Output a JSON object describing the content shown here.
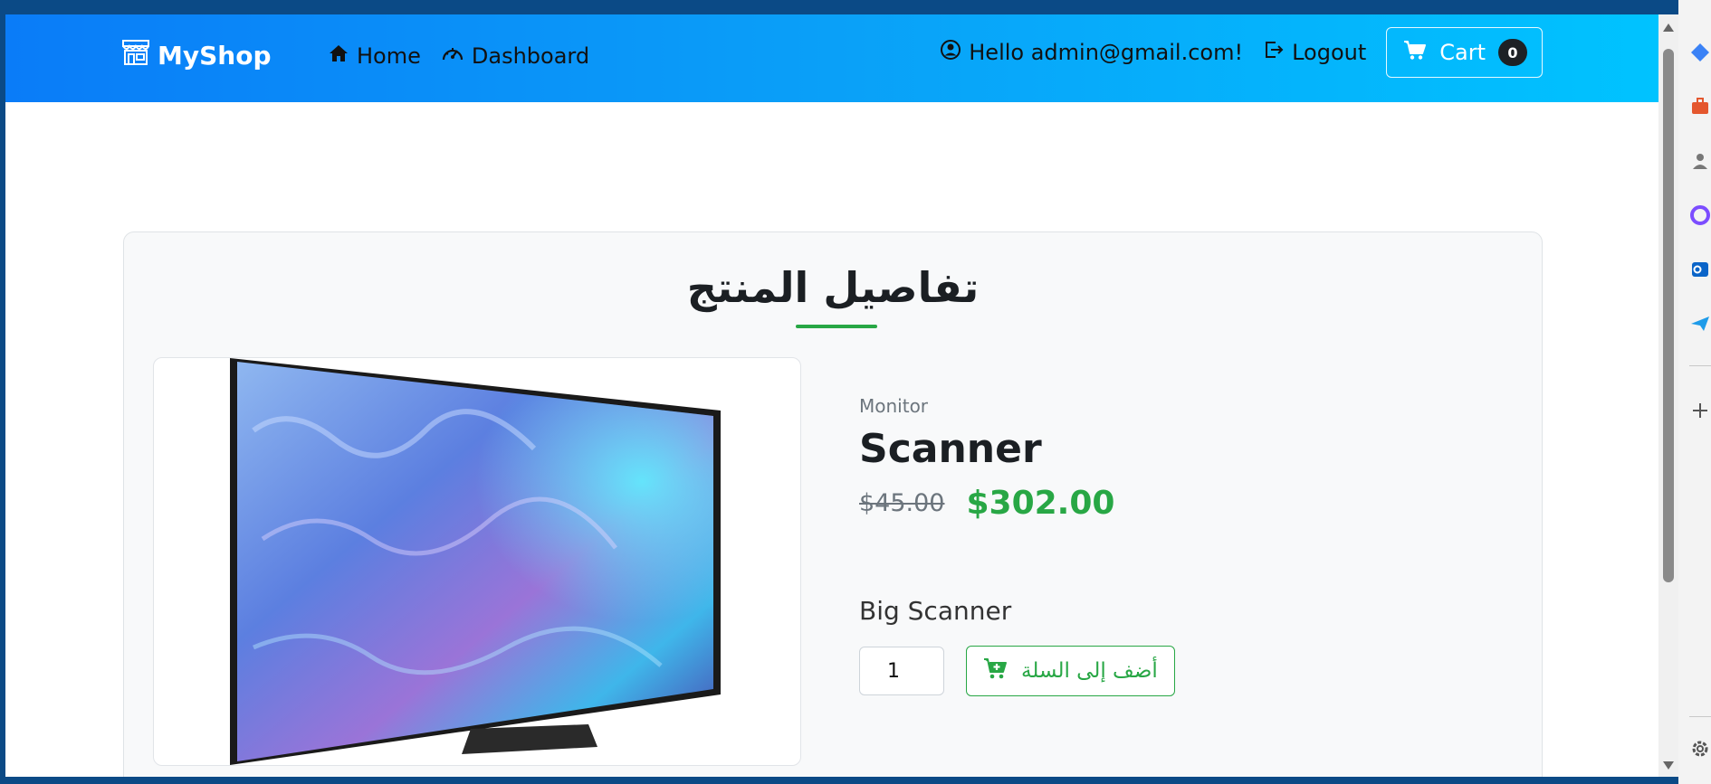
{
  "navbar": {
    "brand": "MyShop",
    "links": [
      "Home",
      "Dashboard"
    ],
    "greeting": "Hello admin@gmail.com!",
    "logout": "Logout",
    "cart_label": "Cart",
    "cart_count": "0"
  },
  "page": {
    "title": "تفاصيل المنتج"
  },
  "product": {
    "category": "Monitor",
    "name": "Scanner",
    "old_price": "$45.00",
    "new_price": "$302.00",
    "description": "Big Scanner",
    "quantity": "1",
    "add_to_cart_label": "أضف إلى السلة"
  },
  "colors": {
    "accent_green": "#28a745",
    "nav_gradient_start": "#0a7cf8",
    "nav_gradient_end": "#00c3ff"
  },
  "icons": {
    "brand": "store-icon",
    "home": "house-icon",
    "dashboard": "speedometer-icon",
    "user": "person-circle-icon",
    "logout": "logout-icon",
    "cart": "cart-icon",
    "add_to_cart": "cart-plus-icon"
  }
}
